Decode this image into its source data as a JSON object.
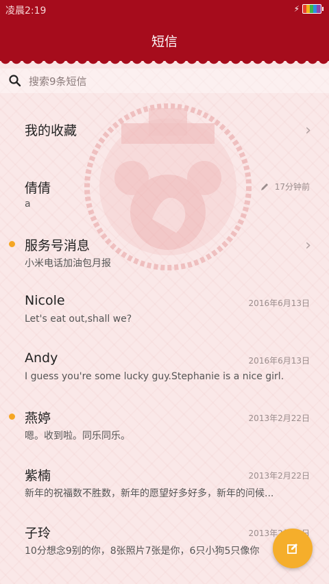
{
  "status_bar": {
    "time": "凌晨2:19"
  },
  "header": {
    "title": "短信"
  },
  "search": {
    "placeholder": "搜索9条短信"
  },
  "conversations": [
    {
      "name": "我的收藏",
      "preview": "",
      "date": "",
      "unread": false,
      "chevron": true
    },
    {
      "name": "倩倩",
      "preview": "a",
      "date": "17分钟前",
      "unread": false,
      "draft": true
    },
    {
      "name": "服务号消息",
      "preview": "小米电话加油包月报",
      "date": "",
      "unread": true,
      "chevron": true
    },
    {
      "name": "Nicole",
      "preview": "Let's eat out,shall we?",
      "date": "2016年6月13日",
      "unread": false
    },
    {
      "name": "Andy",
      "preview": "I guess you're some lucky guy.Stephanie is a nice girl.",
      "date": "2016年6月13日",
      "unread": false
    },
    {
      "name": "燕婷",
      "preview": "嗯。收到啦。同乐同乐。",
      "date": "2013年2月22日",
      "unread": true
    },
    {
      "name": "紫楠",
      "preview": "新年的祝福数不胜数，新年的愿望好多好多，新年的问候...",
      "date": "2013年2月22日",
      "unread": false
    },
    {
      "name": "子玲",
      "preview": "10分想念9别的你，8张照片7张是你，6只小狗5只像你",
      "date": "2013年2月22日",
      "unread": false
    }
  ],
  "colors": {
    "header": "#a60c1c",
    "accent": "#f5a623",
    "fab": "#f5ae2b"
  },
  "icons": {
    "search": "search-icon",
    "compose": "compose-icon",
    "draft": "pencil-icon",
    "chevron": "chevron-right-icon"
  }
}
